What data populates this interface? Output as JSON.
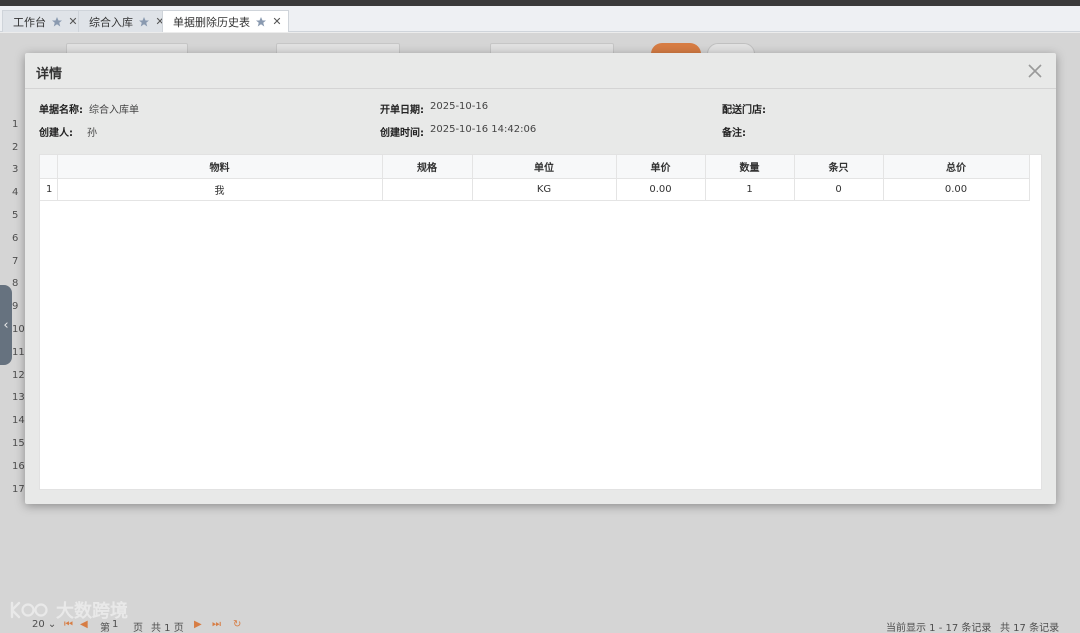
{
  "tabs": [
    {
      "label": "工作台"
    },
    {
      "label": "综合入库"
    },
    {
      "label": "单据删除历史表"
    }
  ],
  "background": {
    "row_numbers": [
      "1",
      "2",
      "3",
      "4",
      "5",
      "6",
      "7",
      "8",
      "9",
      "10",
      "11",
      "12",
      "13",
      "14",
      "15",
      "16",
      "17"
    ],
    "pager": {
      "page_size": "20",
      "page_prefix": "第",
      "page_value": "1",
      "page_suffix": "页",
      "total_pages": "共 1 页",
      "display_info": "当前显示 1 - 17 条记录",
      "total_records": "共 17 条记录"
    },
    "watermark": "大数跨境"
  },
  "dialog": {
    "title": "详情",
    "info": {
      "doc_name_label": "单据名称:",
      "doc_name_value": "综合入库单",
      "open_date_label": "开单日期:",
      "open_date_value": "2025-10-16",
      "store_label": "配送门店:",
      "store_value": "",
      "creator_label": "创建人:",
      "creator_value": "孙",
      "create_time_label": "创建时间:",
      "create_time_value": "2025-10-16 14:42:06",
      "remark_label": "备注:",
      "remark_value": ""
    },
    "table": {
      "headers": [
        "物料",
        "规格",
        "单位",
        "单价",
        "数量",
        "条只",
        "总价"
      ],
      "rows": [
        {
          "num": "1",
          "material": "我",
          "spec": "",
          "unit": "KG",
          "unit_price": "0.00",
          "qty": "1",
          "pieces": "0",
          "total": "0.00"
        }
      ]
    }
  },
  "colors": {
    "accent_orange": "#e8874a",
    "dialog_bg": "#e8e9e8",
    "tab_active": "#ffffff"
  }
}
